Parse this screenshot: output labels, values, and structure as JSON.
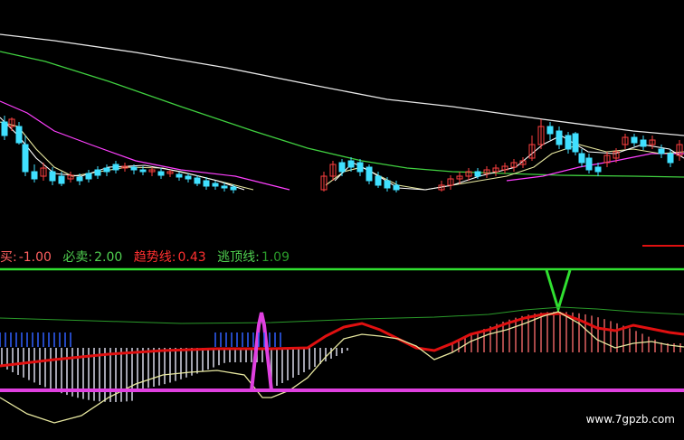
{
  "legend": {
    "buy_label": "买:",
    "buy_value": "-1.00",
    "sell_label": "必卖:",
    "sell_value": "2.00",
    "trend_label": "趋势线:",
    "trend_value": "0.43",
    "top_label": "逃顶线:",
    "top_value": "1.09"
  },
  "watermark": "www.7gpzb.com",
  "colors": {
    "up": "#ff4040",
    "down": "#40e0ff",
    "ma_white": "#e8e8e8",
    "ma_yellow": "#e8e8a0",
    "ma_magenta": "#ff40ff",
    "ma_green": "#40d040",
    "signal_green": "#30e030",
    "trend_red": "#e01010",
    "base_magenta": "#e040e0",
    "legend_white": "#ff6060",
    "legend_red": "#ff3030",
    "legend_green": "#50d050"
  },
  "chart_data": {
    "type": "candlestick-with-indicator",
    "panels": [
      "price",
      "indicator"
    ],
    "legend_values": {
      "买": -1.0,
      "必卖": 2.0,
      "趋势线": 0.43,
      "逃顶线": 1.09
    }
  }
}
